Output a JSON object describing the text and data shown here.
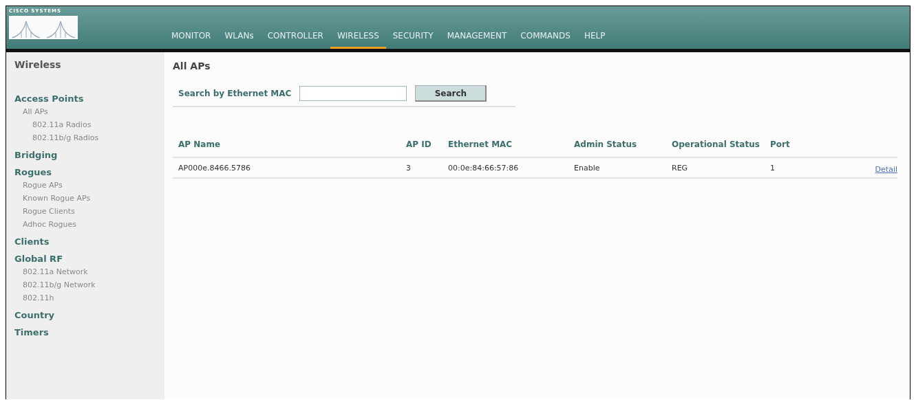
{
  "logo": {
    "text": "CISCO SYSTEMS"
  },
  "nav": [
    {
      "label": "MONITOR",
      "selected": false
    },
    {
      "label": "WLANs",
      "selected": false
    },
    {
      "label": "CONTROLLER",
      "selected": false
    },
    {
      "label": "WIRELESS",
      "selected": true
    },
    {
      "label": "SECURITY",
      "selected": false
    },
    {
      "label": "MANAGEMENT",
      "selected": false
    },
    {
      "label": "COMMANDS",
      "selected": false
    },
    {
      "label": "HELP",
      "selected": false
    }
  ],
  "sidebar": {
    "title": "Wireless",
    "sections": [
      {
        "label": "Access Points",
        "children": [
          {
            "label": "All APs",
            "children": [
              {
                "label": "802.11a Radios"
              },
              {
                "label": "802.11b/g Radios"
              }
            ]
          }
        ]
      },
      {
        "label": "Bridging"
      },
      {
        "label": "Rogues",
        "children": [
          {
            "label": "Rogue APs"
          },
          {
            "label": "Known Rogue APs"
          },
          {
            "label": "Rogue Clients"
          },
          {
            "label": "Adhoc Rogues"
          }
        ]
      },
      {
        "label": "Clients"
      },
      {
        "label": "Global RF",
        "children": [
          {
            "label": "802.11a Network"
          },
          {
            "label": "802.11b/g Network"
          },
          {
            "label": "802.11h"
          }
        ]
      },
      {
        "label": "Country"
      },
      {
        "label": "Timers"
      }
    ]
  },
  "page": {
    "title": "All APs",
    "search": {
      "label": "Search by Ethernet MAC",
      "button": "Search"
    }
  },
  "table": {
    "columns": [
      "AP Name",
      "AP ID",
      "Ethernet MAC",
      "Admin Status",
      "Operational Status",
      "Port"
    ],
    "rows": [
      {
        "cells": [
          "AP000e.8466.5786",
          "3",
          "00:0e:84:66:57:86",
          "Enable",
          "REG",
          "1"
        ],
        "link": "Detail"
      }
    ]
  }
}
